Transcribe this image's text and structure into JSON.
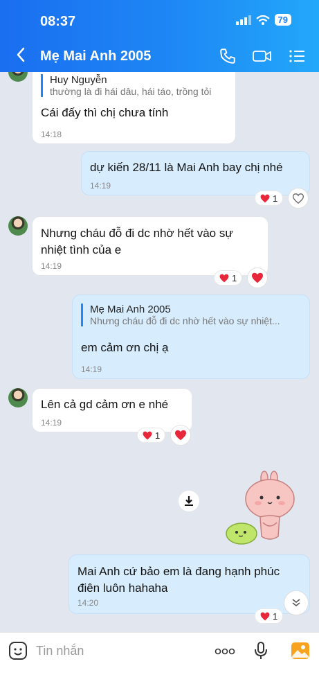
{
  "status": {
    "time": "08:37",
    "battery": "79"
  },
  "header": {
    "title": "Mẹ Mai Anh 2005"
  },
  "messages": [
    {
      "reply_name": "Huy Nguyễn",
      "reply_text": "thường là đi hái dâu, hái táo, trồng tỏi",
      "text": "Cái  đấy  thì chị chưa tính",
      "time": "14:18"
    },
    {
      "text": "dự kiến 28/11 là Mai Anh bay chị nhé",
      "time": "14:19",
      "reactions": "1"
    },
    {
      "line1": "Nhưng cháu đỗ đi dc nhờ hết  vào  sự",
      "line2": "nhiệt tình  của  e",
      "time": "14:19",
      "reactions": "1"
    },
    {
      "reply_name": "Mẹ Mai Anh 2005",
      "reply_text": "Nhưng cháu đỗ đi dc nhờ hết  vào  sự nhiệt...",
      "text": "em cảm ơn chị ạ",
      "time": "14:19"
    },
    {
      "text": "Lên cả  gd cảm ơn  e nhé",
      "time": "14:19",
      "reactions": "1"
    },
    {
      "line1": "Mai Anh cứ bảo em là đang hạnh phúc",
      "line2": "điên luôn hahaha",
      "time": "14:20",
      "reactions": "1"
    }
  ],
  "composer": {
    "placeholder": "Tin nhắn"
  },
  "colors": {
    "header_start": "#1a6ef0",
    "header_end": "#22a8fa",
    "outgoing_bubble": "#d7ecfd",
    "incoming_bubble": "#ffffff",
    "reaction_heart": "#e8283a"
  },
  "icons": [
    "back-icon",
    "phone-icon",
    "video-icon",
    "menu-icon",
    "heart-icon",
    "download-icon",
    "chevron-down-icon",
    "sticker-icon",
    "more-icon",
    "mic-icon",
    "image-icon"
  ]
}
